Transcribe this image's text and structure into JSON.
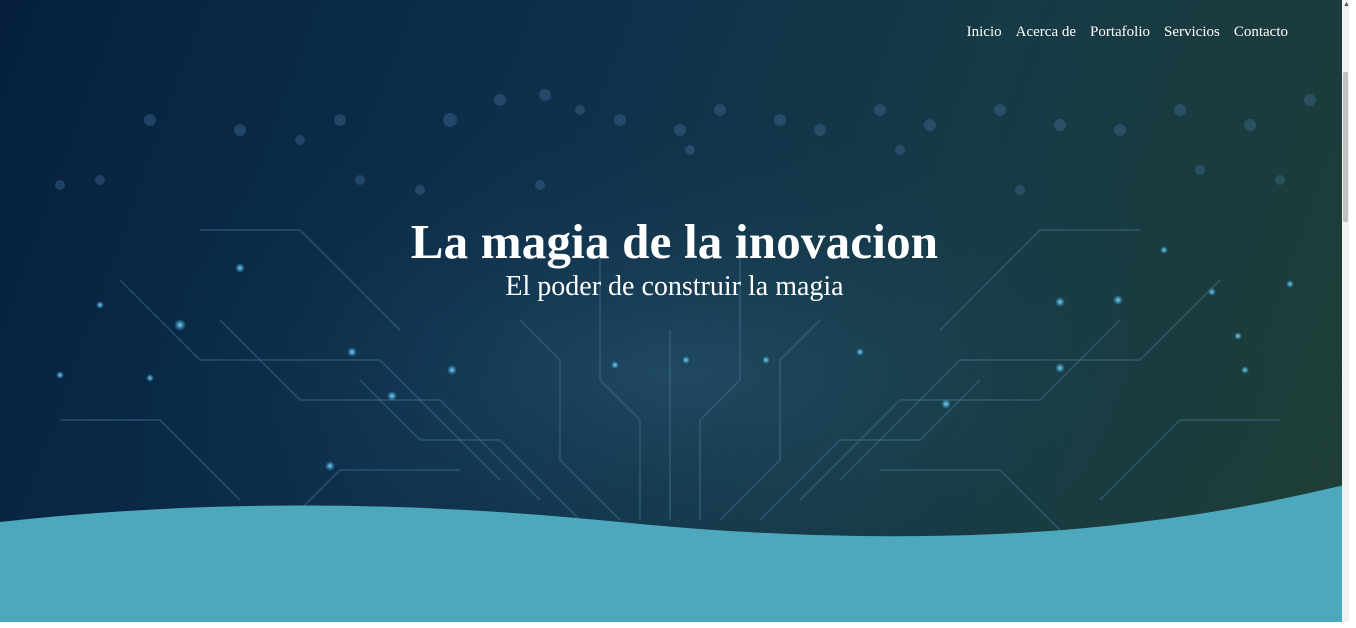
{
  "nav": {
    "items": [
      {
        "label": "Inicio"
      },
      {
        "label": "Acerca de"
      },
      {
        "label": "Portafolio"
      },
      {
        "label": "Servicios"
      },
      {
        "label": "Contacto"
      }
    ]
  },
  "hero": {
    "title": "La magia de la inovacion",
    "subtitle": "El poder de construir la magia",
    "background": "circuit-board-image"
  },
  "colors": {
    "wave": "#4ea8bd",
    "text": "#ffffff",
    "accent_glow": "#3fb6e8"
  }
}
